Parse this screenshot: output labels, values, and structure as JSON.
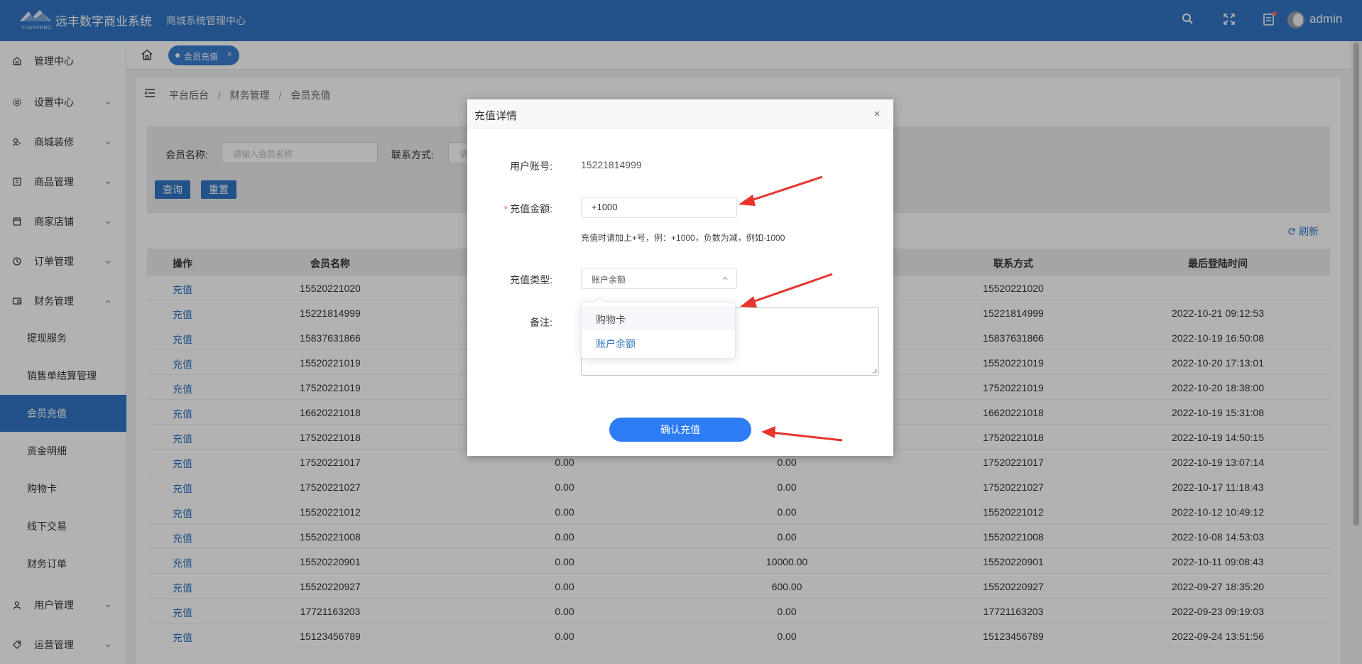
{
  "header": {
    "logo_text": "YUANFENG",
    "app_title": "远丰数字商业系统",
    "subtitle": "商城系统管理中心",
    "user": "admin"
  },
  "sidebar": {
    "items": [
      {
        "label": "管理中心"
      },
      {
        "label": "设置中心"
      },
      {
        "label": "商城装修"
      },
      {
        "label": "商品管理"
      },
      {
        "label": "商家店铺"
      },
      {
        "label": "订单管理"
      },
      {
        "label": "财务管理"
      },
      {
        "label": "用户管理"
      },
      {
        "label": "运营管理"
      }
    ],
    "finance_children": [
      {
        "label": "提现服务"
      },
      {
        "label": "销售单结算管理"
      },
      {
        "label": "会员充值"
      },
      {
        "label": "资金明细"
      },
      {
        "label": "购物卡"
      },
      {
        "label": "线下交易"
      },
      {
        "label": "财务订单"
      }
    ]
  },
  "tabs": {
    "active_tab": "会员充值",
    "close": "×"
  },
  "breadcrumb": [
    "平台后台",
    "财务管理",
    "会员充值"
  ],
  "breadcrumb_sep": "/",
  "search": {
    "member_label": "会员名称:",
    "member_placeholder": "请输入会员名称",
    "contact_label": "联系方式:",
    "contact_placeholder": "请",
    "query_button": "查询",
    "reset_button": "重置"
  },
  "refresh_label": "刷新",
  "table": {
    "columns": [
      "操作",
      "会员名称",
      "联系方式",
      "最后登陆时间"
    ],
    "rows": [
      {
        "action": "充值",
        "name": "15520221020",
        "c1": "",
        "c2": "",
        "contact": "15520221020",
        "login": ""
      },
      {
        "action": "充值",
        "name": "15221814999",
        "c1": "",
        "c2": "",
        "contact": "15221814999",
        "login": "2022-10-21 09:12:53"
      },
      {
        "action": "充值",
        "name": "15837631866",
        "c1": "",
        "c2": "",
        "contact": "15837631866",
        "login": "2022-10-19 16:50:08"
      },
      {
        "action": "充值",
        "name": "15520221019",
        "c1": "",
        "c2": "",
        "contact": "15520221019",
        "login": "2022-10-20 17:13:01"
      },
      {
        "action": "充值",
        "name": "17520221019",
        "c1": "",
        "c2": "",
        "contact": "17520221019",
        "login": "2022-10-20 18:38:00"
      },
      {
        "action": "充值",
        "name": "16620221018",
        "c1": "",
        "c2": "",
        "contact": "16620221018",
        "login": "2022-10-19 15:31:08"
      },
      {
        "action": "充值",
        "name": "17520221018",
        "c1": "",
        "c2": "",
        "contact": "17520221018",
        "login": "2022-10-19 14:50:15"
      },
      {
        "action": "充值",
        "name": "17520221017",
        "c1": "0.00",
        "c2": "0.00",
        "contact": "17520221017",
        "login": "2022-10-19 13:07:14"
      },
      {
        "action": "充值",
        "name": "17520221027",
        "c1": "0.00",
        "c2": "0.00",
        "contact": "17520221027",
        "login": "2022-10-17 11:18:43"
      },
      {
        "action": "充值",
        "name": "15520221012",
        "c1": "0.00",
        "c2": "0.00",
        "contact": "15520221012",
        "login": "2022-10-12 10:49:12"
      },
      {
        "action": "充值",
        "name": "15520221008",
        "c1": "0.00",
        "c2": "0.00",
        "contact": "15520221008",
        "login": "2022-10-08 14:53:03"
      },
      {
        "action": "充值",
        "name": "15520220901",
        "c1": "0.00",
        "c2": "10000.00",
        "contact": "15520220901",
        "login": "2022-10-11 09:08:43"
      },
      {
        "action": "充值",
        "name": "15520220927",
        "c1": "0.00",
        "c2": "600.00",
        "contact": "15520220927",
        "login": "2022-09-27 18:35:20"
      },
      {
        "action": "充值",
        "name": "17721163203",
        "c1": "0.00",
        "c2": "0.00",
        "contact": "17721163203",
        "login": "2022-09-23 09:19:03"
      },
      {
        "action": "充值",
        "name": "15123456789",
        "c1": "0.00",
        "c2": "0.00",
        "contact": "15123456789",
        "login": "2022-09-24 13:51:56"
      }
    ]
  },
  "modal": {
    "title": "充值详情",
    "close": "×",
    "account_label": "用户账号:",
    "account_value": "15221814999",
    "amount_required": "*",
    "amount_label": "充值金额:",
    "amount_value": "+1000",
    "amount_hint": "充值时请加上+号，例：+1000，负数为减，例如-1000",
    "type_label": "充值类型:",
    "type_value": "账户余额",
    "type_options": [
      "购物卡",
      "账户余额"
    ],
    "remark_label": "备注:",
    "confirm_button": "确认充值"
  },
  "colors": {
    "primary": "#3176c4",
    "button": "#2d7cf5",
    "arrow": "#e8342c",
    "required": "#f56c6c"
  }
}
